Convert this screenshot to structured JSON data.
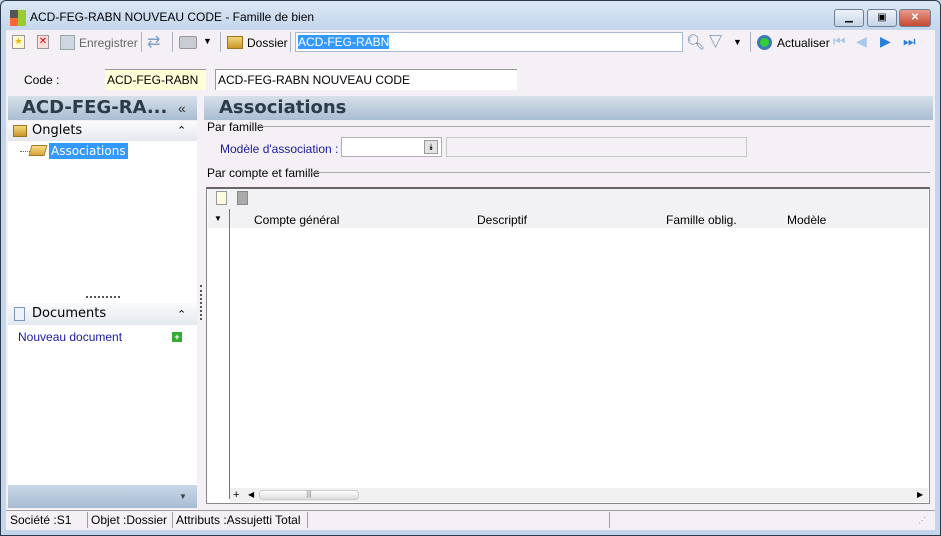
{
  "window": {
    "title": "ACD-FEG-RABN NOUVEAU CODE -  Famille de bien",
    "controls": [
      "minimize",
      "maximize",
      "close"
    ]
  },
  "toolbar": {
    "save_label": "Enregistrer",
    "folder_label": "Dossier",
    "search_value": "ACD-FEG-RABN",
    "refresh_label": "Actualiser"
  },
  "code_row": {
    "label": "Code :",
    "code": "ACD-FEG-RABN",
    "description": "ACD-FEG-RABN NOUVEAU CODE"
  },
  "left_panel": {
    "title": "ACD-FEG-RA...",
    "collapse": "«",
    "tabs_section": "Onglets",
    "tree_items": [
      "Associations"
    ],
    "documents_section": "Documents",
    "new_document": "Nouveau document"
  },
  "main": {
    "title": "Associations",
    "group1": "Par famille",
    "model_label": "Modèle d'association :",
    "model_value": "",
    "model_desc": "",
    "group2": "Par compte et famille",
    "grid": {
      "columns": [
        "Compte général",
        "Descriptif",
        "Famille oblig.",
        "Modèle"
      ],
      "rows": []
    }
  },
  "status": {
    "items": [
      "Société :S1",
      "Objet :Dossier",
      "Attributs :Assujetti Total",
      "",
      ""
    ]
  },
  "colors": {
    "selection": "#3399ff",
    "link": "#1a1aa0"
  }
}
